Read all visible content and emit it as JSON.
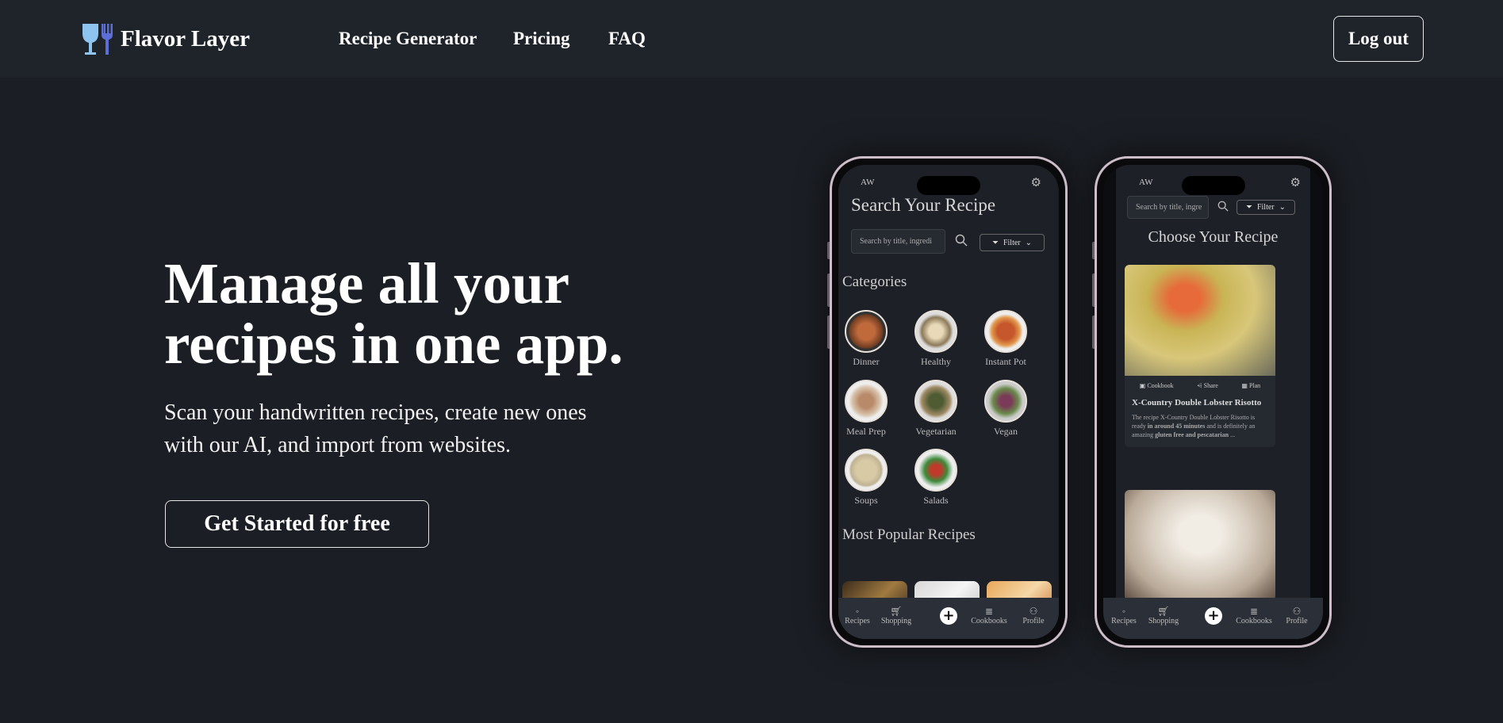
{
  "nav": {
    "brand": "Flavor Layer",
    "links": [
      "Recipe Generator",
      "Pricing",
      "FAQ"
    ],
    "logout_label": "Log out"
  },
  "hero": {
    "title_line1": "Manage all your",
    "title_line2": "recipes in one app.",
    "subtitle_line1": "Scan your handwritten recipes, create new ones",
    "subtitle_line2": "with our AI, and import from websites.",
    "cta_label": "Get Started for free"
  },
  "phone1": {
    "initials": "AW",
    "title": "Search Your Recipe",
    "search_placeholder": "Search by title, ingredi",
    "filter_label": "Filter",
    "categories_title": "Categories",
    "categories": [
      "Dinner",
      "Healthy",
      "Instant Pot",
      "Meal Prep",
      "Vegetarian",
      "Vegan",
      "Soups",
      "Salads"
    ],
    "popular_title": "Most Popular Recipes",
    "tabs": [
      "Recipes",
      "Shopping",
      "Cookbooks",
      "Profile"
    ]
  },
  "phone2": {
    "initials": "AW",
    "search_placeholder": "Search by title, ingre",
    "filter_label": "Filter",
    "title": "Choose Your Recipe",
    "card": {
      "actions": [
        "Cookbook",
        "Share",
        "Plan"
      ],
      "title": "X-Country Double Lobster Risotto",
      "desc_prefix": "The recipe X-Country Double Lobster Risotto is ready ",
      "desc_bold1": "in around 45 minutes",
      "desc_mid": " and is definitely an amazing ",
      "desc_bold2": "gluten free and pescatarian",
      "desc_suffix": " ..."
    },
    "tabs": [
      "Recipes",
      "Shopping",
      "Cookbooks",
      "Profile"
    ]
  },
  "colors": {
    "background": "#1b1e24",
    "nav_background": "#1f232a",
    "logo_glass": "#8ec5f0",
    "logo_fork": "#5b6fd6"
  }
}
